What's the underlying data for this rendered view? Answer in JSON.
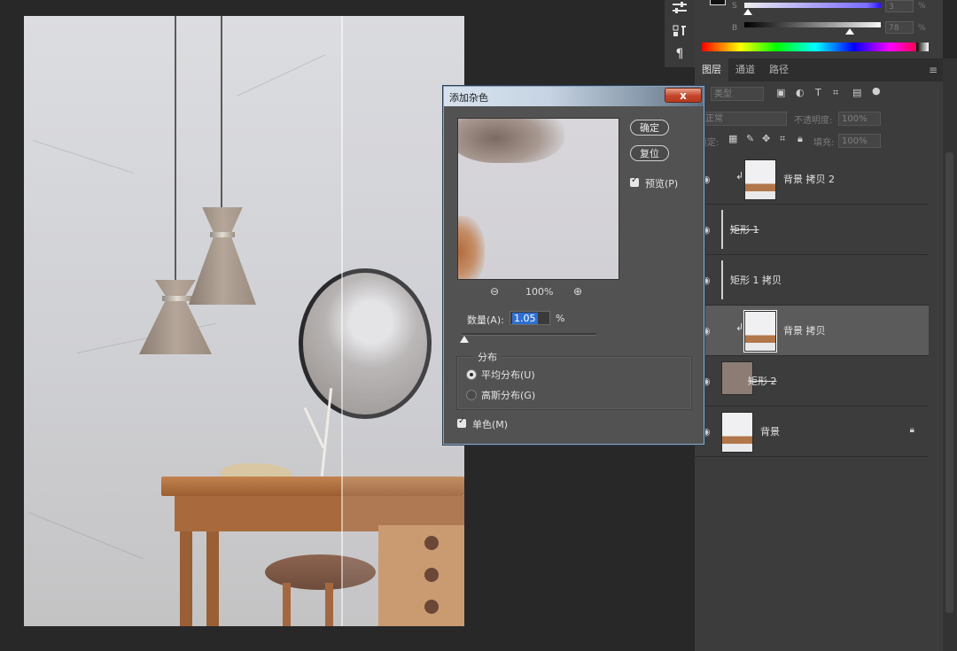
{
  "tool_strip": {
    "icons": [
      "adjustments-icon",
      "text-properties-icon",
      "paragraph-icon"
    ],
    "paragraph_glyph": "¶"
  },
  "color_panel": {
    "channels": [
      {
        "label": "S",
        "value": "3"
      },
      {
        "label": "B",
        "value": "78"
      }
    ],
    "percent": "%"
  },
  "layers_panel": {
    "tabs": [
      "图层",
      "通道",
      "路径"
    ],
    "filter_kind": "类型",
    "blend_mode": "正常",
    "opacity_label": "不透明度:",
    "opacity_value": "100%",
    "lock_label": "锁定:",
    "fill_label": "填充:",
    "fill_value": "100%",
    "layers": [
      {
        "name": "背景 拷贝 2",
        "thumb": "photo",
        "clipped": true,
        "selected": false,
        "strike": false,
        "locked": false
      },
      {
        "name": "矩形 1",
        "thumb": "dark",
        "clipped": false,
        "selected": false,
        "strike": true,
        "locked": false
      },
      {
        "name": "矩形 1 拷贝",
        "thumb": "thin",
        "clipped": false,
        "selected": false,
        "strike": false,
        "locked": false
      },
      {
        "name": "背景 拷贝",
        "thumb": "photo",
        "clipped": true,
        "selected": true,
        "strike": false,
        "locked": false
      },
      {
        "name": "矩形 2",
        "thumb": "taupe",
        "clipped": false,
        "selected": false,
        "strike": true,
        "locked": false
      },
      {
        "name": "背景",
        "thumb": "photo",
        "clipped": false,
        "selected": false,
        "strike": false,
        "locked": true
      }
    ]
  },
  "dialog": {
    "title": "添加杂色",
    "close_label": "x",
    "ok_label": "确定",
    "reset_label": "复位",
    "preview_label": "预览(P)",
    "zoom_out_glyph": "⊖",
    "zoom_in_glyph": "⊕",
    "zoom_value": "100%",
    "amount_label": "数量(A):",
    "amount_value": "1.05",
    "amount_unit": "%",
    "amount_slider_fraction": 0.0026,
    "distribution_label": "分布",
    "uniform_label": "平均分布(U)",
    "gaussian_label": "高斯分布(G)",
    "selected_distribution": "uniform",
    "monochromatic_label": "单色(M)",
    "preview_checked": true,
    "monochromatic_checked": true
  }
}
